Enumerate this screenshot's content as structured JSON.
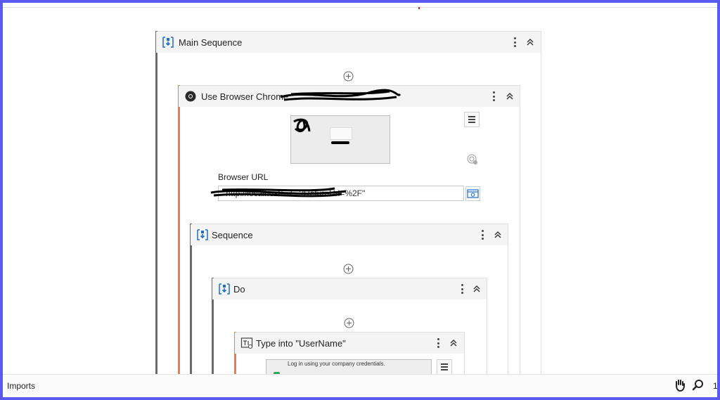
{
  "activities": {
    "main_sequence": {
      "title": "Main Sequence"
    },
    "use_browser": {
      "title": "Use Browser Chrome: "
    },
    "sequence": {
      "title": "Sequence"
    },
    "do": {
      "title": "Do"
    },
    "type_into": {
      "title": "Type into \"UserName\""
    }
  },
  "browser": {
    "url_label": "Browser URL",
    "url_value": "\"http://localhost/.../...?ReturnUrl=%2F\""
  },
  "type_into_preview": {
    "text": "Log in using your company credentials."
  },
  "statusbar": {
    "imports_label": "Imports",
    "zoom_text": "1"
  },
  "colors": {
    "accent_blue": "#1f6fc4",
    "orange_bar": "#ef7d4b",
    "gray_bar": "#6b6b6b",
    "frame": "#5a5af0"
  },
  "icons": [
    "sequence-icon",
    "chrome-icon",
    "type-into-icon",
    "add-activity-icon",
    "more-options-icon",
    "collapse-icon",
    "menu-icon",
    "target-icon",
    "browser-icon",
    "hand-icon",
    "zoom-icon"
  ]
}
